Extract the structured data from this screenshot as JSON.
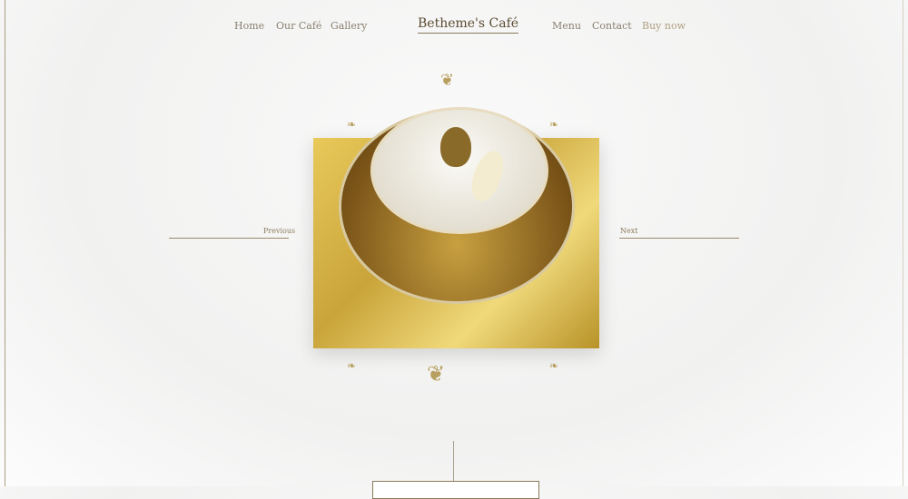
{
  "nav": {
    "left": [
      "Home",
      "Our Café",
      "Gallery"
    ],
    "brand": "Betheme's Café",
    "right": [
      "Menu",
      "Contact",
      "Buy now"
    ]
  },
  "slider": {
    "previous": "Previous",
    "next": "Next"
  },
  "colors": {
    "accent": "#c9a43a",
    "text": "#8a8070"
  }
}
